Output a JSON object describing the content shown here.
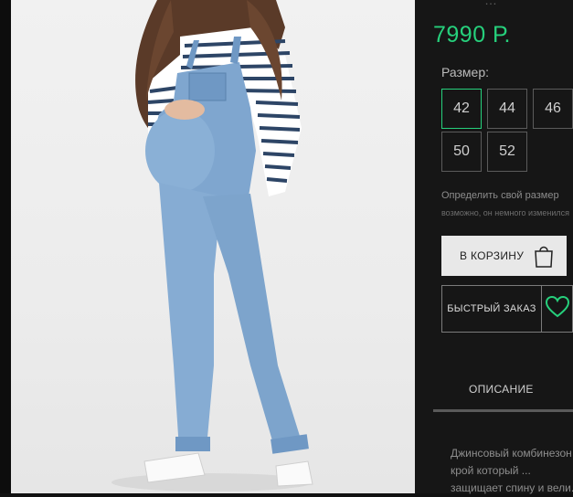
{
  "price": "7990 Р.",
  "price_top_fragment": "…",
  "size_label": "Размер:",
  "sizes": [
    "42",
    "44",
    "46",
    "50",
    "52"
  ],
  "selected_size": "42",
  "find_size_link": "Определить свой размер",
  "find_size_note": "возможно, он немного изменился",
  "cart_button": "В КОРЗИНУ",
  "quick_order_button": "БЫСТРЫЙ ЗАКАЗ",
  "tab_description": "ОПИСАНИЕ",
  "description_lines": [
    "Джинсовый комбинезон",
    "крой который ...",
    "защищает спину и вели..."
  ],
  "colors": {
    "accent": "#26d07c",
    "panel_bg": "#161616",
    "button_light": "#e8e8e8"
  },
  "icons": {
    "cart": "shopping-bag-icon",
    "favorite": "heart-icon"
  }
}
